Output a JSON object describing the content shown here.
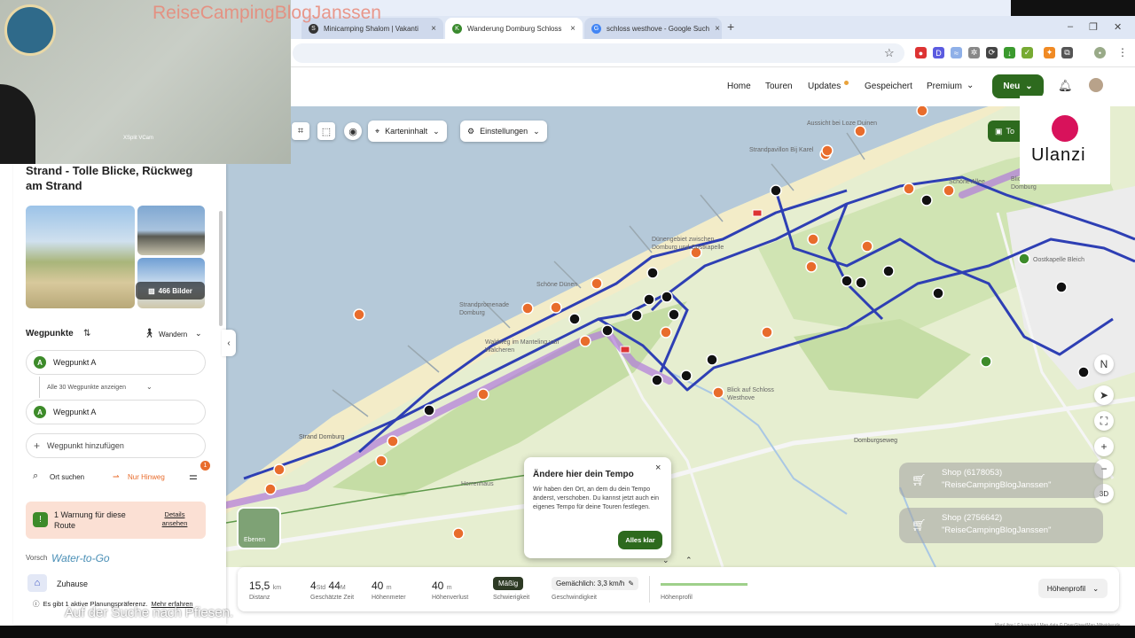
{
  "browser": {
    "tabs": [
      {
        "title": "Minicamping Shalom | Vakanti",
        "favicon_color": "#333333",
        "favicon_glyph": "S"
      },
      {
        "title": "Wanderung Domburg Schloss",
        "favicon_color": "#3a8a2e",
        "favicon_glyph": "K"
      },
      {
        "title": "schloss westhove - Google Such",
        "favicon_color": "#4285f4",
        "favicon_glyph": "G"
      }
    ],
    "new_tab": "+"
  },
  "overlay": {
    "blog_watermark": "ReiseCampingBlogJanssen",
    "webcam_label": "XSplit VCam",
    "ulanzi": "Ulanzi",
    "subtitle": "Auf der Suche nach Pfiesen.",
    "shops": [
      {
        "title": "Shop (6178053)",
        "name": "\"ReiseCampingBlogJanssen\""
      },
      {
        "title": "Shop (2756642)",
        "name": "\"ReiseCampingBlogJanssen\""
      }
    ]
  },
  "site": {
    "nav": [
      "Home",
      "Touren",
      "Updates",
      "Gespeichert",
      "Premium"
    ],
    "new_button": "Neu"
  },
  "map_toolbar": {
    "content": "Karteninhalt",
    "settings": "Einstellungen",
    "tour_button": "To",
    "layers": "Ebenen"
  },
  "map_labels": [
    "Aussicht bei Loze Duinen",
    "Strandpavillon Bij Karel",
    "Blick auf den Strand von Domburg",
    "Dünengebiet zwischen Domburg und Oostkapelle",
    "Schöne Dünen",
    "Strandpromenade Domburg",
    "Waldweg im Manteling van Walcheren",
    "Blick auf Schloss Westhove",
    "Oostkapelle Bleich",
    "Domburgseweg",
    "Herrenhaus",
    "Schöne Allee",
    "Strand Domburg"
  ],
  "sidebar": {
    "title": "Strand - Tolle Blicke, Rückweg am Strand",
    "photos_count": "466 Bilder",
    "waypoints_label": "Wegpunkte",
    "mode": "Wandern",
    "waypoint_start": "Wegpunkt A",
    "show_all": "Alle 30 Wegpunkte anzeigen",
    "waypoint_end": "Wegpunkt A",
    "add_waypoint": "Wegpunkt hinzufügen",
    "search_place": "Ort suchen",
    "only_hint": "Nur Hinweg",
    "filter_badge": "1",
    "warning": "1 Warnung für diese Route",
    "warning_details": "Details ansehen",
    "suggestions_label": "Vorsch",
    "water_brand": "Water-to-Go",
    "home": "Zuhause",
    "plan_info": "Es gibt 1 aktive Planungspräferenz.",
    "plan_more": "Mehr erfahren"
  },
  "popup": {
    "title": "Ändere hier dein Tempo",
    "body": "Wir haben den Ort, an dem du dein Tempo änderst, verschoben. Du kannst jetzt auch ein eigenes Tempo für deine Touren festlegen.",
    "button": "Alles klar"
  },
  "stats": {
    "distance": {
      "value": "15,5",
      "unit": "km",
      "label": "Distanz"
    },
    "time": {
      "h": "4",
      "h_unit": "Std",
      "m": "44",
      "m_unit": "M",
      "label": "Geschätzte Zeit"
    },
    "uphill": {
      "value": "40",
      "unit": "m",
      "label": "Höhenmeter"
    },
    "downhill": {
      "value": "40",
      "unit": "m",
      "label": "Höhenverlust"
    },
    "difficulty": {
      "value": "Mäßig",
      "label": "Schwierigkeit"
    },
    "speed": {
      "value": "Gemächlich: 3,3 km/h",
      "label": "Geschwindigkeit"
    },
    "profile_label": "Höhenprofil",
    "profile_button": "Höhenprofil"
  },
  "attribution": "MapLibre | © komoot | Map data © OpenStreetMap-Mitwirkende",
  "colors": {
    "brand_green": "#2d6a1e",
    "route_blue": "#2e3fb4",
    "route_purple": "#b07bdc",
    "poi_orange": "#e86c2c",
    "sea": "#b5c9d9",
    "land": "#e3edc9",
    "beach": "#f3ecc8",
    "forest": "#c7dfa8"
  }
}
